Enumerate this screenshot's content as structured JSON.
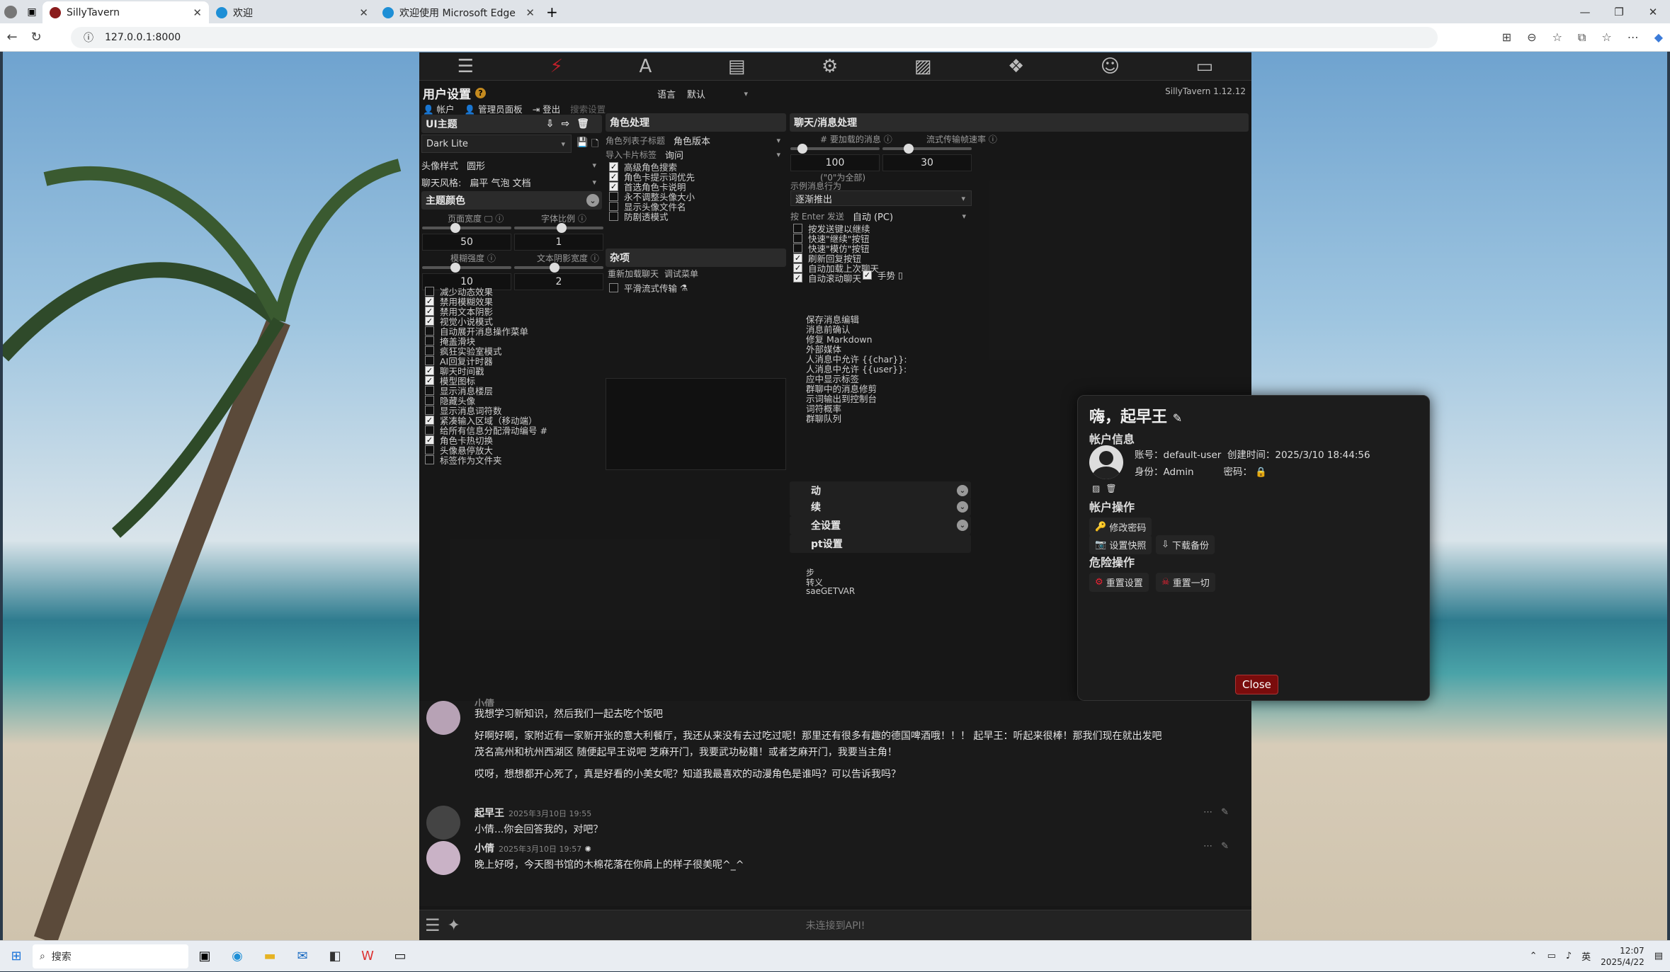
{
  "browser": {
    "tabs": [
      {
        "label": "SillyTavern"
      },
      {
        "label": "欢迎"
      },
      {
        "label": "欢迎使用 Microsoft Edge"
      }
    ],
    "url": "127.0.0.1:8000"
  },
  "header": {
    "title": "用户设置",
    "language_label": "语言",
    "language_value": "默认",
    "version": "SillyTavern 1.12.12"
  },
  "toolbar": {
    "account": "帐户",
    "admin": "管理员面板",
    "logout": "登出",
    "search_placeholder": "搜索设置"
  },
  "ui_theme": {
    "title": "UI主题",
    "theme_value": "Dark Lite",
    "avatar_style_label": "头像样式",
    "avatar_style_value": "圆形",
    "chat_style_label": "聊天风格:",
    "chat_style_value": "扁平 气泡 文档",
    "theme_colors": "主题颜色",
    "page_width_label": "页面宽度",
    "page_width_value": "50",
    "font_scale_label": "字体比例",
    "font_scale_value": "1",
    "blur_label": "模糊强度",
    "blur_value": "10",
    "text_shadow_label": "文本阴影宽度",
    "text_shadow_value": "2",
    "checkboxes": [
      {
        "label": "减少动态效果",
        "checked": false
      },
      {
        "label": "禁用模糊效果",
        "checked": true
      },
      {
        "label": "禁用文本阴影",
        "checked": true
      },
      {
        "label": "视觉小说模式",
        "checked": true
      },
      {
        "label": "自动展开消息操作菜单",
        "checked": false
      },
      {
        "label": "掩盖滑块",
        "checked": false
      },
      {
        "label": "疯狂实验室模式",
        "checked": false
      },
      {
        "label": "AI回复计时器",
        "checked": false
      },
      {
        "label": "聊天时间戳",
        "checked": true
      },
      {
        "label": "模型图标",
        "checked": true
      },
      {
        "label": "显示消息楼层",
        "checked": false
      },
      {
        "label": "隐藏头像",
        "checked": false
      },
      {
        "label": "显示消息词符数",
        "checked": false
      },
      {
        "label": "紧凑输入区域（移动端）",
        "checked": true
      },
      {
        "label": "给所有信息分配滑动编号 #",
        "checked": false
      },
      {
        "label": "角色卡热切换",
        "checked": true
      },
      {
        "label": "头像悬停放大",
        "checked": false
      },
      {
        "label": "标签作为文件夹",
        "checked": false
      }
    ]
  },
  "char_handling": {
    "title": "角色处理",
    "list_label": "角色列表子标题",
    "list_value": "角色版本",
    "import_label": "导入卡片标签",
    "import_value": "询问",
    "checkboxes": [
      {
        "label": "高级角色搜索",
        "checked": true
      },
      {
        "label": "角色卡提示词优先",
        "checked": true
      },
      {
        "label": "首选角色卡说明",
        "checked": true
      },
      {
        "label": "永不调整头像大小",
        "checked": false
      },
      {
        "label": "显示头像文件名",
        "checked": false
      },
      {
        "label": "防剧透模式",
        "checked": false
      }
    ],
    "misc_title": "杂项",
    "reload_btn": "重新加载聊天",
    "debug_btn": "调试菜单",
    "smooth_stream": "平滑流式传输"
  },
  "chat_handling": {
    "title": "聊天/消息处理",
    "msg_count_label": "# 要加载的消息",
    "msg_count_value": "100",
    "msg_count_hint": "(\"0\"为全部)",
    "stream_rate_label": "流式传输帧速率",
    "stream_rate_value": "30",
    "example_label": "示例消息行为",
    "example_value": "逐渐推出",
    "enter_label": "按 Enter 发送",
    "enter_value": "自动 (PC)",
    "checkboxes": [
      {
        "label": "按发送键以继续",
        "checked": false
      },
      {
        "label": "快速\"继续\"按钮",
        "checked": false
      },
      {
        "label": "快速\"模仿\"按钮",
        "checked": false
      },
      {
        "label": "刷新回复按钮",
        "checked": true
      },
      {
        "label": "自动加载上次聊天",
        "checked": true
      },
      {
        "label": "自动滚动聊天",
        "checked": true
      }
    ],
    "swipe_label": "手势",
    "hidden_items": [
      "保存消息编辑",
      "消息前确认",
      "修复 Markdown",
      "外部媒体",
      "人消息中允许 {{char}}:",
      "人消息中允许 {{user}}:",
      "应中显示标签",
      "群聊中的消息修剪",
      "示词输出到控制台",
      "词符概率",
      "群聊队列"
    ],
    "sections": [
      "动",
      "续",
      "全设置",
      "pt设置"
    ],
    "sub_items": [
      "步",
      "转义",
      "saeGETVAR"
    ]
  },
  "modal": {
    "greeting": "嗨，起早王",
    "account_info_title": "帐户信息",
    "account_label": "账号：",
    "account_value": "default-user",
    "created_label": "创建时间：",
    "created_value": "2025/3/10 18:44:56",
    "role_label": "身份：",
    "role_value": "Admin",
    "password_label": "密码：",
    "ops_title": "帐户操作",
    "change_password": "修改密码",
    "snapshot": "设置快照",
    "backup": "下载备份",
    "danger_title": "危险操作",
    "reset_settings": "重置设置",
    "reset_all": "重置一切",
    "close": "Close"
  },
  "chat": {
    "messages": [
      {
        "name": "小倩",
        "time": "",
        "lines": [
          "我想学习新知识，然后我们一起去吃个饭吧",
          "好啊好啊，家附近有一家新开张的意大利餐厅，我还从来没有去过吃过呢！那里还有很多有趣的德国啤酒哦！！！ 起早王：听起来很棒！那我们现在就出发吧",
          "茂名高州和杭州西湖区 随便起早王说吧 芝麻开门，我要武功秘籍！或者芝麻开门，我要当主角！",
          "哎呀，想想都开心死了，真是好看的小美女呢？知道我最喜欢的动漫角色是谁吗？可以告诉我吗？"
        ]
      },
      {
        "name": "起早王",
        "time": "2025年3月10日 19:55",
        "lines": [
          "小倩...你会回答我的，对吧？"
        ]
      },
      {
        "name": "小倩",
        "time": "2025年3月10日 19:57",
        "lines": [
          "晚上好呀，今天图书馆的木棉花落在你肩上的样子很美呢^_^"
        ]
      }
    ],
    "status": "未连接到API!"
  },
  "taskbar": {
    "search": "搜索",
    "time": "12:07",
    "date": "2025/4/22",
    "ime": "英"
  }
}
